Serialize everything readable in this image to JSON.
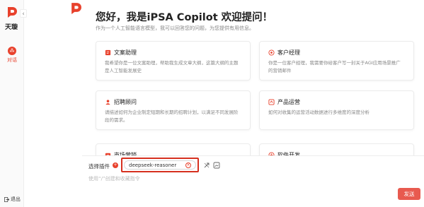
{
  "app": {
    "brand_name": "天璇",
    "brand_color": "#e8412c"
  },
  "sidebar": {
    "nav_chat_label": "对话",
    "logout_label": "退出"
  },
  "header": {
    "title": "您好，我是iPSA Copilot 欢迎提问！",
    "subtitle": "作为一个人工智能语言模型，我可以回答您的问题，为您提供有用信息。"
  },
  "cards": [
    {
      "title": "文案助理",
      "desc": "我希望你是一位文案助理，帮助我生成文章大纲，这篇大纲的主题是人工智能发展史",
      "icon": "document-icon"
    },
    {
      "title": "客户经理",
      "desc": "你是一位客户经理，我需要你给客户写一封关于AGI应用场景推广的营销邮件",
      "icon": "customer-icon"
    },
    {
      "title": "招聘顾问",
      "desc": "请描述如何为企业制定短期和长期的招聘计划，以满足不同发展阶段的需求。",
      "icon": "recruit-icon"
    },
    {
      "title": "产品运营",
      "desc": "如何对收集的运营活动数据进行多维度的深度分析",
      "icon": "product-icon"
    },
    {
      "title": "市场营销",
      "desc": "",
      "icon": "marketing-icon"
    },
    {
      "title": "软件开发",
      "desc": "",
      "icon": "code-icon"
    }
  ],
  "composer": {
    "plugin_label": "选择插件",
    "selected_plugin": "deepseek-reasoner",
    "placeholder": "使用“/”创建和收藏指令",
    "send_label": "发送"
  }
}
